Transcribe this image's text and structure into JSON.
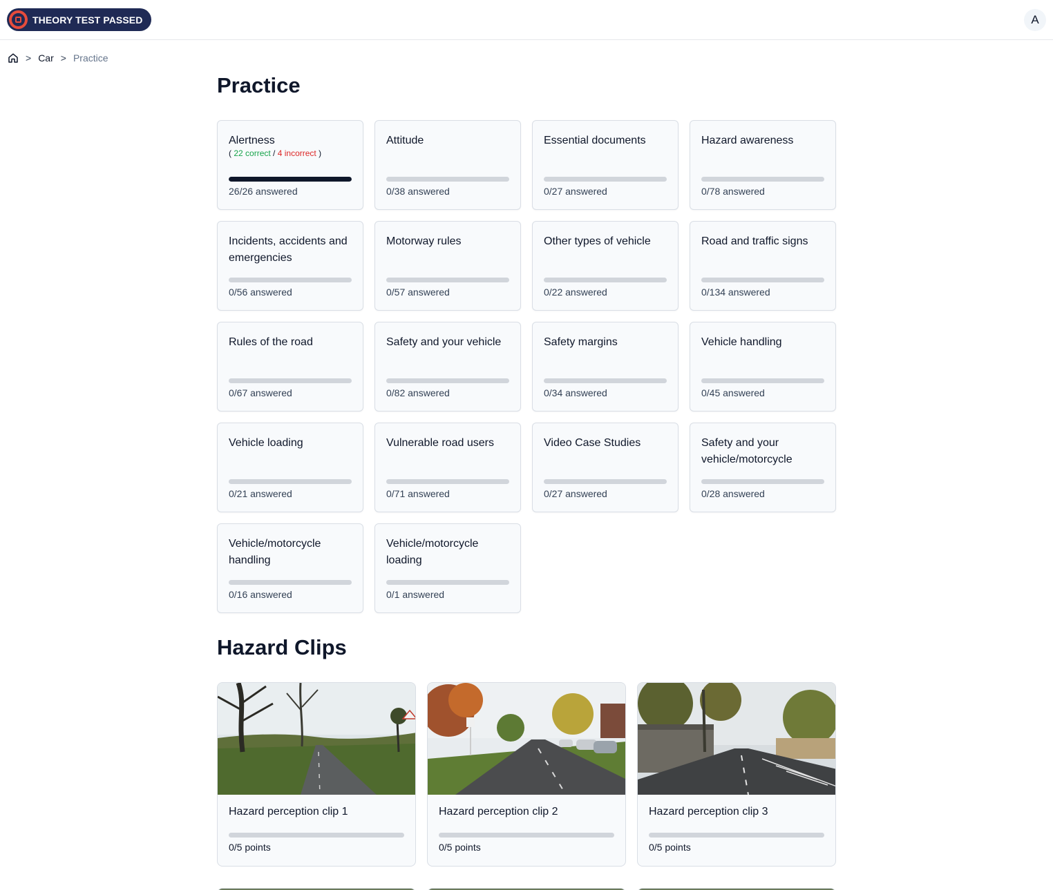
{
  "header": {
    "logo_text": "THEORY TEST PASSED",
    "avatar_initial": "A"
  },
  "breadcrumb": {
    "home_icon": "home-icon",
    "separator": ">",
    "items": [
      "Car",
      "Practice"
    ]
  },
  "practice": {
    "heading": "Practice",
    "cards": [
      {
        "title": "Alertness",
        "answered": "26/26 answered",
        "progress": 1.0,
        "score": {
          "open": "(",
          "correct": "22 correct",
          "slash": "/",
          "incorrect": "4 incorrect",
          "close": ")"
        }
      },
      {
        "title": "Attitude",
        "answered": "0/38 answered",
        "progress": 0
      },
      {
        "title": "Essential documents",
        "answered": "0/27 answered",
        "progress": 0
      },
      {
        "title": "Hazard awareness",
        "answered": "0/78 answered",
        "progress": 0
      },
      {
        "title": "Incidents, accidents and emergencies",
        "answered": "0/56 answered",
        "progress": 0
      },
      {
        "title": "Motorway rules",
        "answered": "0/57 answered",
        "progress": 0
      },
      {
        "title": "Other types of vehicle",
        "answered": "0/22 answered",
        "progress": 0
      },
      {
        "title": "Road and traffic signs",
        "answered": "0/134 answered",
        "progress": 0
      },
      {
        "title": "Rules of the road",
        "answered": "0/67 answered",
        "progress": 0
      },
      {
        "title": "Safety and your vehicle",
        "answered": "0/82 answered",
        "progress": 0
      },
      {
        "title": "Safety margins",
        "answered": "0/34 answered",
        "progress": 0
      },
      {
        "title": "Vehicle handling",
        "answered": "0/45 answered",
        "progress": 0
      },
      {
        "title": "Vehicle loading",
        "answered": "0/21 answered",
        "progress": 0
      },
      {
        "title": "Vulnerable road users",
        "answered": "0/71 answered",
        "progress": 0
      },
      {
        "title": "Video Case Studies",
        "answered": "0/27 answered",
        "progress": 0
      },
      {
        "title": "Safety and your vehicle/motorcycle",
        "answered": "0/28 answered",
        "progress": 0
      },
      {
        "title": "Vehicle/motorcycle handling",
        "answered": "0/16 answered",
        "progress": 0
      },
      {
        "title": "Vehicle/motorcycle loading",
        "answered": "0/1 answered",
        "progress": 0
      }
    ]
  },
  "hazard_clips": {
    "heading": "Hazard Clips",
    "clips": [
      {
        "title": "Hazard perception clip 1",
        "points": "0/5 points",
        "progress": 0
      },
      {
        "title": "Hazard perception clip 2",
        "points": "0/5 points",
        "progress": 0
      },
      {
        "title": "Hazard perception clip 3",
        "points": "0/5 points",
        "progress": 0
      }
    ]
  },
  "colors": {
    "brand_navy": "#1f2a55",
    "brand_red": "#e74c3c",
    "correct": "#16a34a",
    "incorrect": "#dc2626",
    "progress_fill": "#0f172a",
    "progress_track": "#d1d5db"
  }
}
